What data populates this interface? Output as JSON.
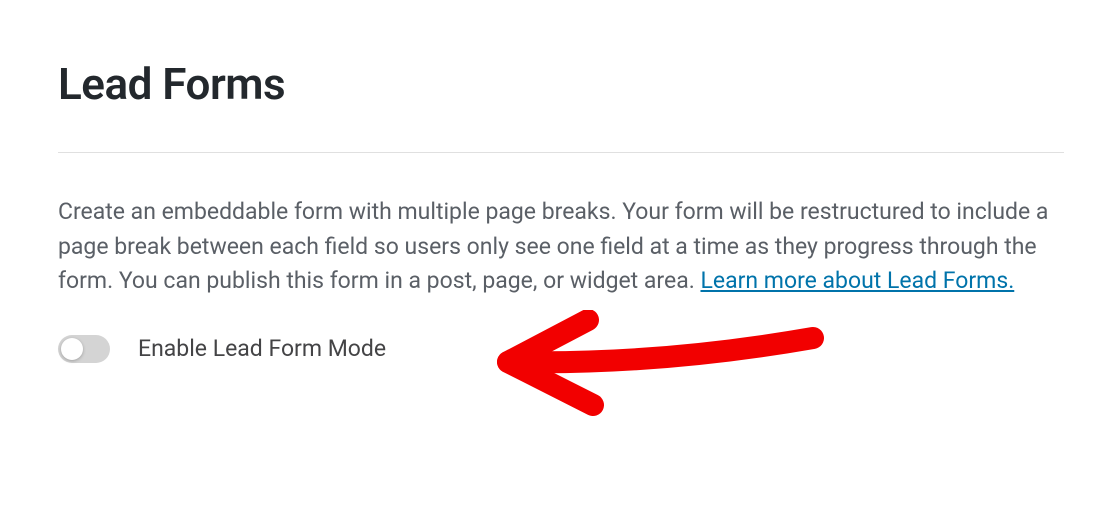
{
  "header": {
    "title": "Lead Forms"
  },
  "section": {
    "description_prefix": "Create an embeddable form with multiple page breaks. Your form will be restructured to include a page break between each field so users only see one field at a time as they progress through the form. You can publish this form in a post, page, or widget area. ",
    "learn_more_label": "Learn more about Lead Forms."
  },
  "toggle": {
    "label": "Enable Lead Form Mode",
    "state": "off"
  },
  "annotation": {
    "color": "#f20000"
  }
}
